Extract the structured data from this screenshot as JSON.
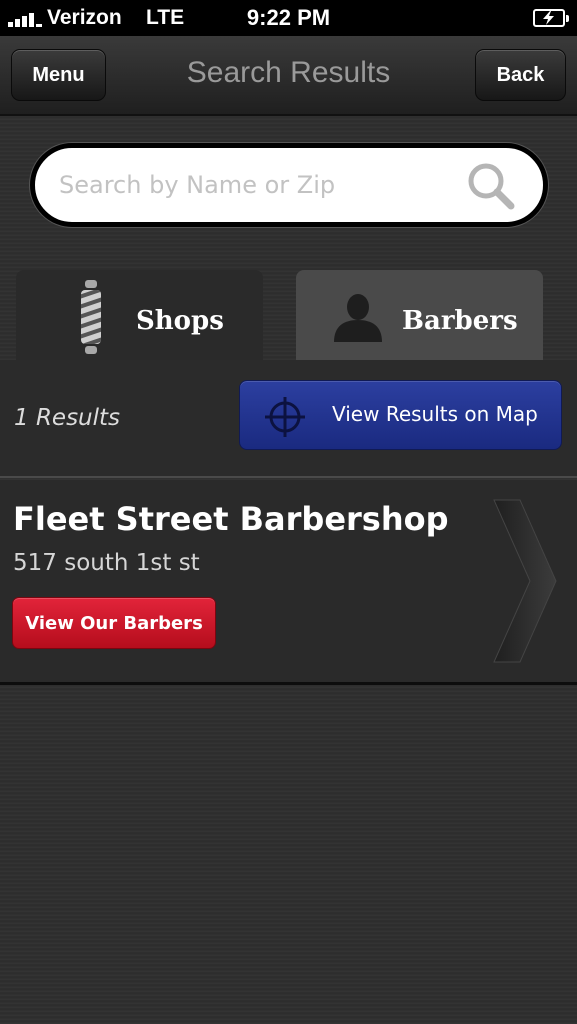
{
  "status_bar": {
    "carrier": "Verizon",
    "network": "LTE",
    "time": "9:22 PM"
  },
  "nav": {
    "title": "Search Results",
    "menu_label": "Menu",
    "back_label": "Back"
  },
  "search": {
    "placeholder": "Search by Name or Zip",
    "value": ""
  },
  "tabs": [
    {
      "label": "Shops",
      "icon": "barber-pole-icon",
      "selected": true
    },
    {
      "label": "Barbers",
      "icon": "person-icon",
      "selected": false
    }
  ],
  "results": {
    "count_text": "1 Results",
    "map_button_label": "View Results on Map"
  },
  "items": [
    {
      "name": "Fleet Street Barbershop",
      "address": "517 south 1st st",
      "button_label": "View Our Barbers"
    }
  ],
  "colors": {
    "map_button": "#23358f",
    "barbers_button": "#d0172b",
    "background": "#2e2e2e"
  }
}
